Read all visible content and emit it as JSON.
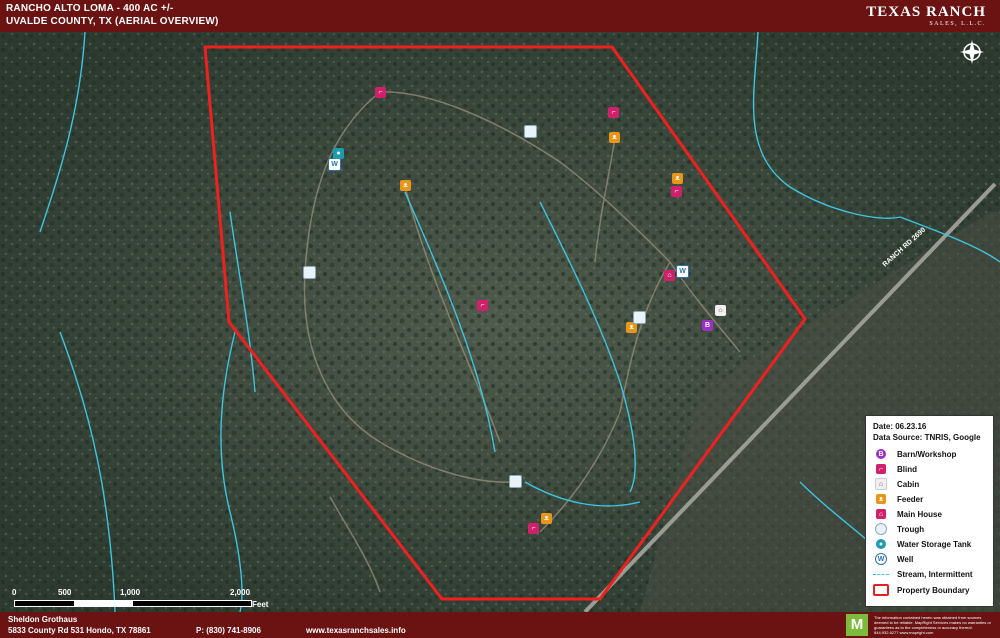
{
  "header": {
    "title": "RANCHO ALTO LOMA - 400 AC +/-",
    "subtitle": "UVALDE COUNTY, TX  (AERIAL OVERVIEW)"
  },
  "logo": {
    "name": "TEXAS RANCH",
    "sub": "SALES, L.L.C."
  },
  "road_label": "RANCH RD 2690",
  "scale": {
    "ticks": [
      "0",
      "500",
      "1,000",
      "2,000"
    ],
    "unit": "Feet"
  },
  "legend": {
    "date": "Date: 06.23.16",
    "source": "Data Source: TNRIS, Google",
    "items": [
      {
        "label": "Barn/Workshop",
        "icon": "barn-icon",
        "color": "#9b30c8"
      },
      {
        "label": "Blind",
        "icon": "blind-icon",
        "color": "#d0206c"
      },
      {
        "label": "Cabin",
        "icon": "cabin-icon",
        "color": "#f0f0f0"
      },
      {
        "label": "Feeder",
        "icon": "feeder-icon",
        "color": "#e8961a"
      },
      {
        "label": "Main House",
        "icon": "house-icon",
        "color": "#d0206c"
      },
      {
        "label": "Trough",
        "icon": "trough-icon",
        "color": "#e8f2f8"
      },
      {
        "label": "Water Storage Tank",
        "icon": "tank-icon",
        "color": "#1e9ab0"
      },
      {
        "label": "Well",
        "icon": "well-icon",
        "color": "#2a6fb8"
      },
      {
        "label": "Stream, Intermittent",
        "icon": "stream-icon",
        "color": "#3fc4e0"
      },
      {
        "label": "Property Boundary",
        "icon": "boundary-icon",
        "color": "#e52020"
      }
    ]
  },
  "footer": {
    "name": "Sheldon Grothaus",
    "address": "5833 County Rd 531 Hondo, TX 78861",
    "phone": "P: (830) 741-8906",
    "website": "www.texasranchsales.info",
    "disclaimer": "The information contained herein was obtained from sources deemed to be reliable. MapRight Services makes no warranties or guarantees as to the completeness or accuracy thereof. 844.932.6277  www.mapright.com",
    "m": "M"
  }
}
